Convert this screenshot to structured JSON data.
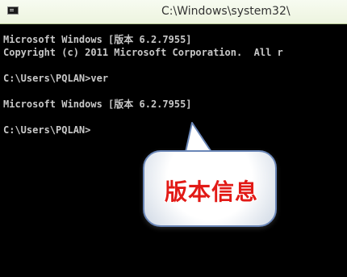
{
  "window": {
    "title": "C:\\Windows\\system32\\"
  },
  "console": {
    "lines": [
      "Microsoft Windows [版本 6.2.7955]",
      "Copyright (c) 2011 Microsoft Corporation.  All r",
      "",
      "C:\\Users\\PQLAN>ver",
      "",
      "Microsoft Windows [版本 6.2.7955]",
      "",
      "C:\\Users\\PQLAN>"
    ]
  },
  "callout": {
    "text": "版本信息"
  },
  "colors": {
    "background": "#cfe0a9",
    "console_bg": "#000000",
    "console_text": "#c8c8c8",
    "callout_text": "#e21a16",
    "callout_border": "#6a86b7"
  },
  "icons": {
    "app": "cmd-icon"
  }
}
